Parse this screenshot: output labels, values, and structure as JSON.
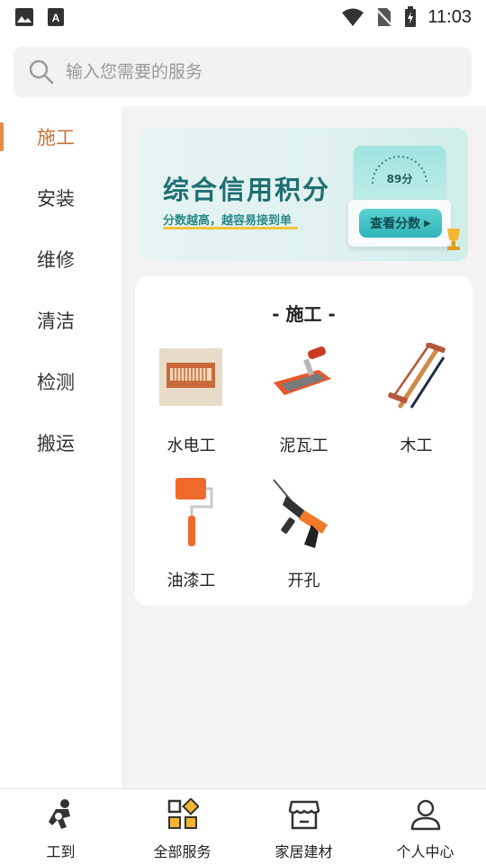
{
  "status_bar": {
    "time": "11:03",
    "icons": [
      "image-icon",
      "text-app-icon",
      "wifi-icon",
      "no-sim-icon",
      "battery-charging-icon"
    ]
  },
  "search": {
    "placeholder": "输入您需要的服务",
    "value": ""
  },
  "sidebar": {
    "items": [
      {
        "label": "施工",
        "active": true
      },
      {
        "label": "安装",
        "active": false
      },
      {
        "label": "维修",
        "active": false
      },
      {
        "label": "清洁",
        "active": false
      },
      {
        "label": "检测",
        "active": false
      },
      {
        "label": "搬运",
        "active": false
      }
    ]
  },
  "banner": {
    "title": "综合信用积分",
    "subtitle": "分数越高，越容易接到单",
    "score": "89分",
    "button_label": "查看分数",
    "accent_color": "#2fb4b8"
  },
  "category": {
    "title": "- 施工 -",
    "items": [
      {
        "label": "水电工",
        "icon": "electrical-box-icon"
      },
      {
        "label": "泥瓦工",
        "icon": "trowel-icon"
      },
      {
        "label": "木工",
        "icon": "saw-icon"
      },
      {
        "label": "油漆工",
        "icon": "paint-roller-icon"
      },
      {
        "label": "开孔",
        "icon": "drill-icon"
      }
    ]
  },
  "bottom_nav": {
    "items": [
      {
        "label": "工到",
        "icon": "worker-run-icon"
      },
      {
        "label": "全部服务",
        "icon": "grid-services-icon"
      },
      {
        "label": "家居建材",
        "icon": "store-icon"
      },
      {
        "label": "个人中心",
        "icon": "person-icon"
      }
    ]
  },
  "colors": {
    "accent": "#e38c4a",
    "active_text": "#c6753a",
    "main_bg": "#f3f3f3"
  }
}
